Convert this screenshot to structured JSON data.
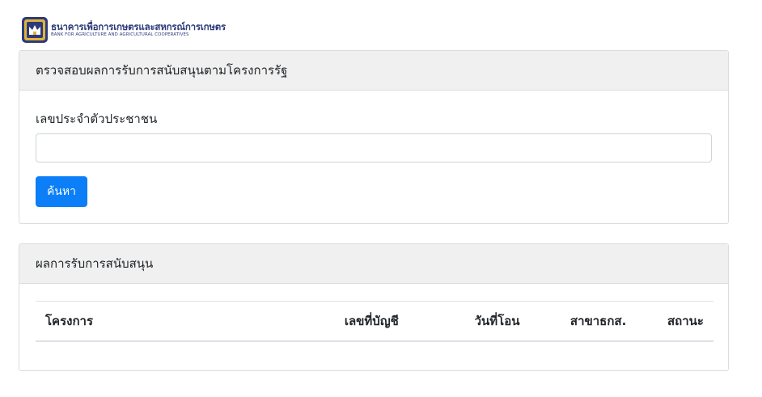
{
  "logo": {
    "thai": "ธนาคารเพื่อการเกษตรและสหกรณ์การเกษตร",
    "english": "BANK FOR AGRICULTURE AND AGRICULTURAL COOPERATIVES",
    "colors": {
      "navy": "#2d3a7a",
      "gold": "#e0b43a"
    }
  },
  "search_card": {
    "title": "ตรวจสอบผลการรับการสนับสนุนตามโครงการรัฐ",
    "id_label": "เลขประจำตัวประชาชน",
    "id_value": "",
    "search_label": "ค้นหา"
  },
  "results_card": {
    "title": "ผลการรับการสนับสนุน",
    "columns": [
      "โครงการ",
      "เลขที่บัญชี",
      "วันที่โอน",
      "สาขาธกส.",
      "สถานะ"
    ]
  },
  "colors": {
    "primary_button": "#0b7ef8",
    "card_header_bg": "#f0f0f0"
  }
}
